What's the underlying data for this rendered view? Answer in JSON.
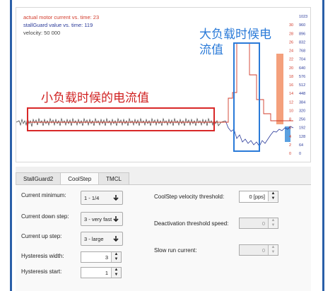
{
  "legend": {
    "current": "actual motor current vs. time: 23",
    "stallguard": "stallGuard value vs. time: 119",
    "velocity": "velocity: 50 000"
  },
  "right_axis": {
    "col1": [
      "30",
      "28",
      "26",
      "24",
      "22",
      "20",
      "18",
      "16",
      "14",
      "12",
      "10",
      "8",
      "6",
      "4",
      "2",
      "0"
    ],
    "col2": [
      "1023",
      "960",
      "896",
      "832",
      "768",
      "704",
      "640",
      "576",
      "512",
      "448",
      "384",
      "320",
      "256",
      "192",
      "128",
      "64",
      "0"
    ]
  },
  "annotations": {
    "high_load": "大负载时候电流值",
    "low_load": "小负载时候的电流值"
  },
  "tabs": [
    "StallGuard2",
    "CoolStep",
    "TMCL"
  ],
  "active_tab": "CoolStep",
  "coolstep": {
    "current_minimum": {
      "label": "Current minimum:",
      "value": "1 - 1/4"
    },
    "current_down_step": {
      "label": "Current down step:",
      "value": "3 - very fast"
    },
    "current_up_step": {
      "label": "Current up step:",
      "value": "3 - large"
    },
    "hysteresis_width": {
      "label": "Hysteresis width:",
      "value": "3"
    },
    "hysteresis_start": {
      "label": "Hysteresis start:",
      "value": "1"
    },
    "velocity_threshold": {
      "label": "CoolStep velocity threshold:",
      "value": "0 [pps]"
    },
    "deactivation_speed": {
      "label": "Deactivation threshold speed:",
      "value": "0"
    },
    "slow_run_current": {
      "label": "Slow run current:",
      "value": "0"
    }
  },
  "colors": {
    "current_line": "#d23a2a",
    "stallguard_line": "#2a3a9a",
    "annotation_blue": "#2a7ad8",
    "annotation_red": "#d82828",
    "bar_orange": "#f4a07c",
    "bar_blue": "#5aa0e0"
  }
}
